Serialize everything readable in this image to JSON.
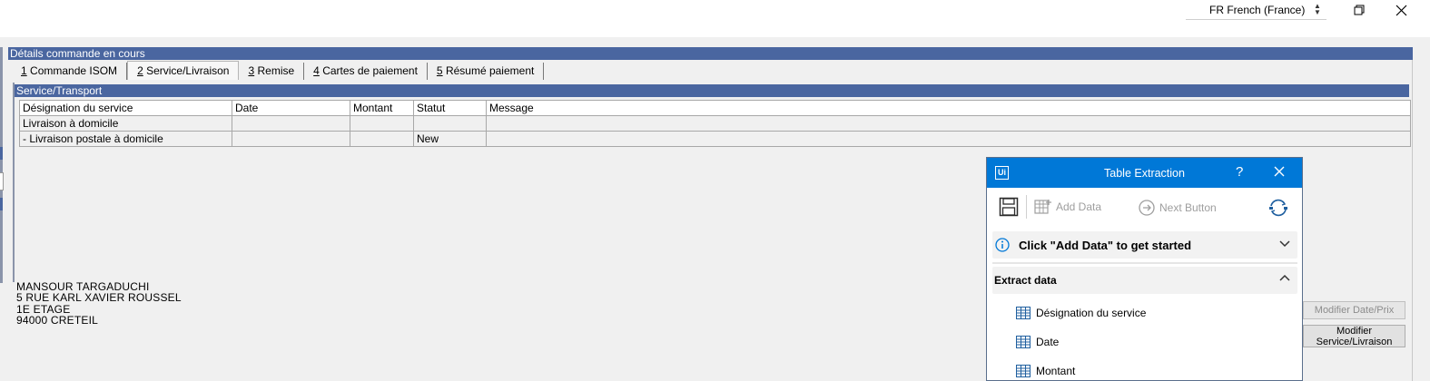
{
  "topbar": {
    "language": "FR French (France)"
  },
  "panel": {
    "title": "Détails commande en cours",
    "tabs": [
      {
        "num": "1",
        "label": " Commande ISOM"
      },
      {
        "num": "2",
        "label": " Service/Livraison"
      },
      {
        "num": "3",
        "label": " Remise"
      },
      {
        "num": "4",
        "label": " Cartes de paiement"
      },
      {
        "num": "5",
        "label": " Résumé paiement"
      }
    ]
  },
  "service": {
    "title": "Service/Transport",
    "columns": [
      "Désignation du service",
      "Date",
      "Montant",
      "Statut",
      "Message"
    ],
    "rows": [
      [
        "Livraison à domicile",
        "",
        "",
        "",
        ""
      ],
      [
        "- Livraison postale à domicile",
        "",
        "",
        "New",
        ""
      ]
    ]
  },
  "address": {
    "lines": [
      "MANSOUR  TARGADUCHI",
      "5 RUE KARL XAVIER ROUSSEL",
      "1E ETAGE",
      "94000  CRETEIL"
    ]
  },
  "buttons": {
    "modify_date": "Modifier Date/Prix",
    "modify_service_line1": "Modifier",
    "modify_service_line2": "Service/Livraison"
  },
  "dialog": {
    "title": "Table Extraction",
    "help": "?",
    "add_data": "Add Data",
    "next_button": "Next Button",
    "hint": "Click \"Add Data\" to get started",
    "extract_title": "Extract data",
    "fields": [
      "Désignation du service",
      "Date",
      "Montant"
    ]
  },
  "colors": {
    "header_blue": "#4a66a0",
    "dialog_blue": "#0078d7"
  }
}
